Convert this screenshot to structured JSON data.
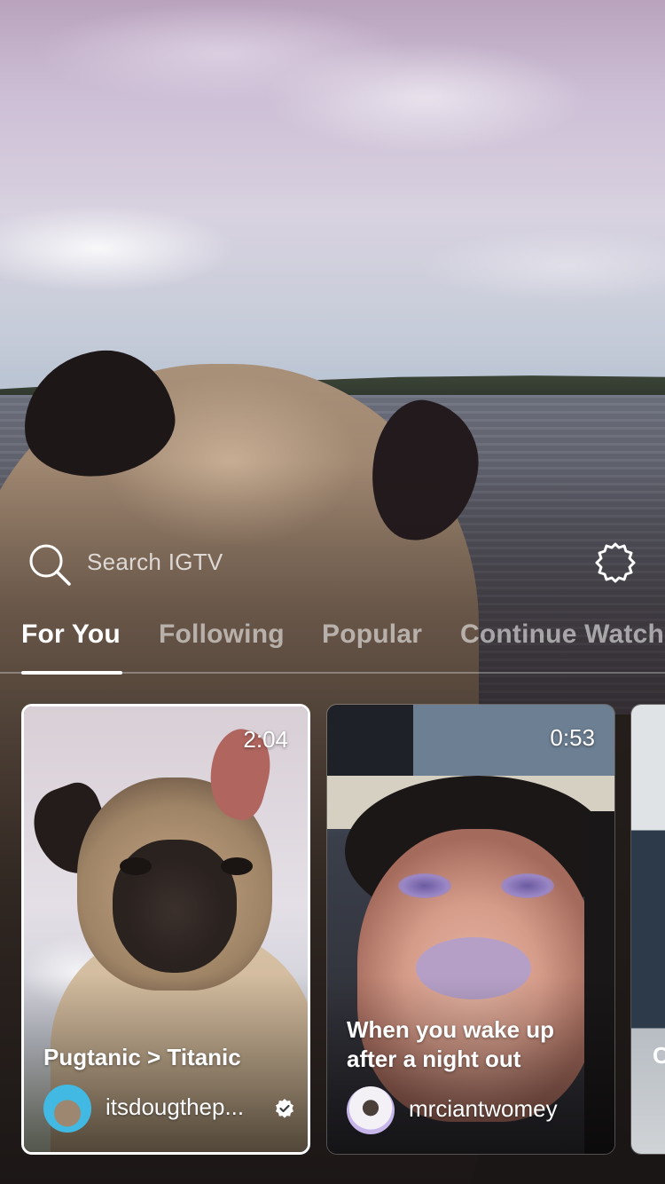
{
  "search": {
    "placeholder": "Search IGTV"
  },
  "tabs": [
    {
      "label": "For You"
    },
    {
      "label": "Following"
    },
    {
      "label": "Popular"
    },
    {
      "label": "Continue Watching"
    }
  ],
  "active_tab": "For You",
  "cards": [
    {
      "duration": "2:04",
      "title": "Pugtanic > Titanic",
      "username": "itsdougthep...",
      "verified": true
    },
    {
      "duration": "0:53",
      "title": "When you wake up after a night out",
      "username": "mrciantwomey",
      "verified": false
    },
    {
      "title_fragment": "C"
    }
  ],
  "icons": {
    "search": "search-icon",
    "settings": "gear-icon",
    "verified": "verified-badge-icon"
  },
  "colors": {
    "text": "#ffffff",
    "muted_text": "rgba(255,255,255,0.55)",
    "active_underline": "#ffffff"
  }
}
